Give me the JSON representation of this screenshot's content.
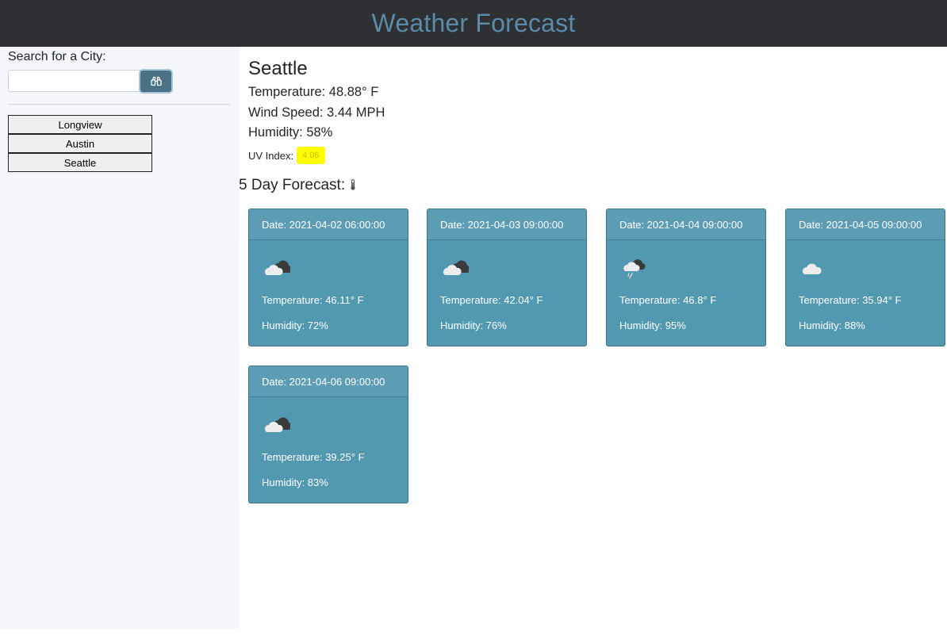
{
  "header": {
    "title": "Weather Forecast"
  },
  "sidebar": {
    "search_label": "Search for a City:",
    "search_value": "",
    "search_placeholder": "",
    "history": [
      "Longview",
      "Austin",
      "Seattle"
    ]
  },
  "current": {
    "city": "Seattle",
    "temperature": "Temperature: 48.88° F",
    "wind": "Wind Speed: 3.44 MPH",
    "humidity": "Humidity: 58%",
    "uv_label": "UV Index:",
    "uv_value": "4.06"
  },
  "forecast": {
    "title": "5 Day Forecast:",
    "title_icon": "thermometer-icon",
    "days": [
      {
        "date": "Date: 2021-04-02 06:00:00",
        "icon": "broken-clouds-icon",
        "temp": "Temperature: 46.11° F",
        "humidity": "Humidity: 72%"
      },
      {
        "date": "Date: 2021-04-03 09:00:00",
        "icon": "broken-clouds-icon",
        "temp": "Temperature: 42.04° F",
        "humidity": "Humidity: 76%"
      },
      {
        "date": "Date: 2021-04-04 09:00:00",
        "icon": "rain-cloud-icon",
        "temp": "Temperature: 46.8° F",
        "humidity": "Humidity: 95%"
      },
      {
        "date": "Date: 2021-04-05 09:00:00",
        "icon": "cloud-icon",
        "temp": "Temperature: 35.94° F",
        "humidity": "Humidity: 88%"
      },
      {
        "date": "Date: 2021-04-06 09:00:00",
        "icon": "broken-clouds-icon",
        "temp": "Temperature: 39.25° F",
        "humidity": "Humidity: 83%"
      }
    ]
  },
  "colors": {
    "header_bg": "#2e3034",
    "title": "#5b8ba8",
    "card_bg": "#5298b1",
    "uv_badge": "#ffff00",
    "search_button": "#4a7185"
  }
}
